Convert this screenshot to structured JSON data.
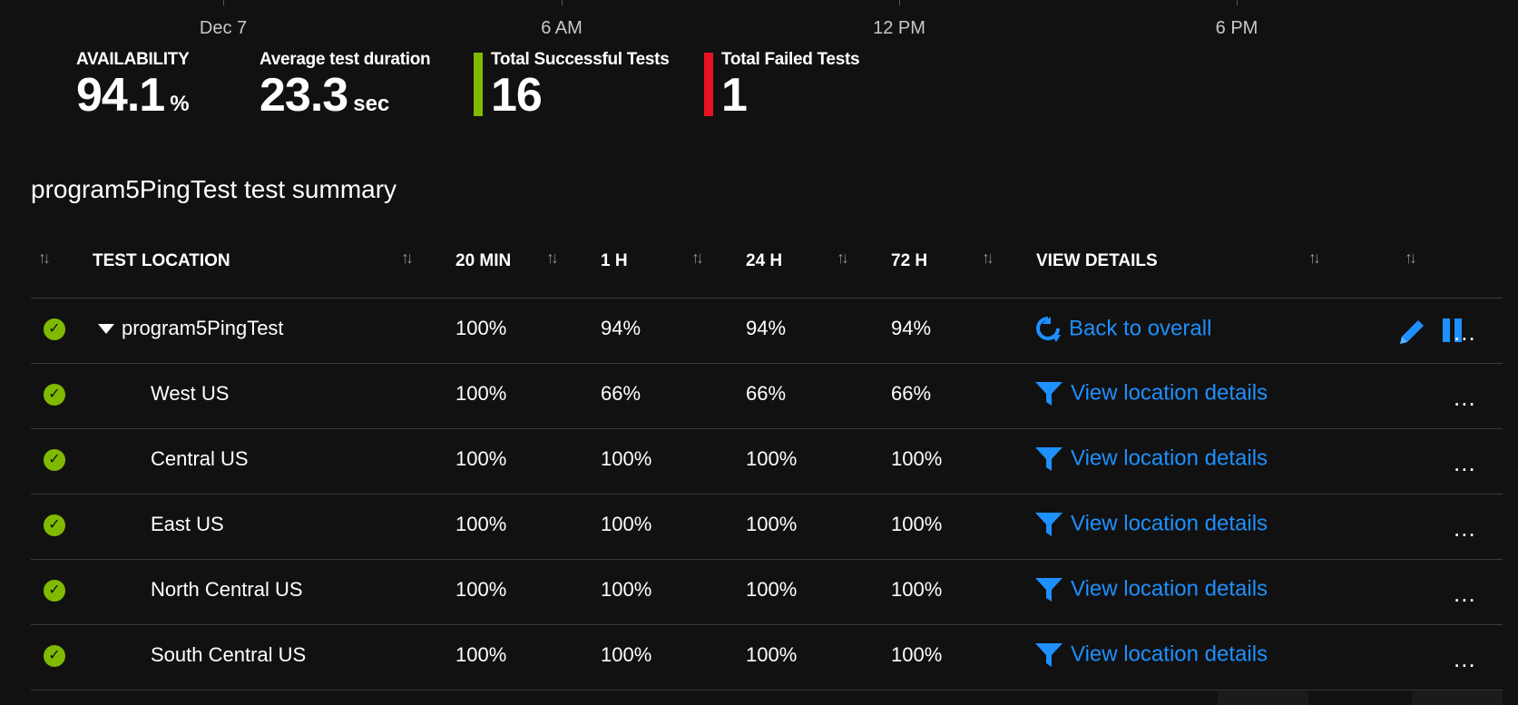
{
  "axis": {
    "labels": [
      "Dec 7",
      "6 AM",
      "12 PM",
      "6 PM"
    ]
  },
  "metrics": {
    "availability": {
      "label": "AVAILABILITY",
      "value": "94.1",
      "unit": "%"
    },
    "duration": {
      "label": "Average test duration",
      "value": "23.3",
      "unit": "sec"
    },
    "successful": {
      "label": "Total Successful Tests",
      "value": "16",
      "color": "#7fba00"
    },
    "failed": {
      "label": "Total Failed Tests",
      "value": "1",
      "color": "#e81123"
    }
  },
  "summary_title": "program5PingTest test summary",
  "table": {
    "columns": [
      "TEST LOCATION",
      "20 MIN",
      "1 H",
      "24 H",
      "72 H",
      "VIEW DETAILS"
    ],
    "rows": [
      {
        "location": "program5PingTest",
        "m20": "100%",
        "h1": "94%",
        "h24": "94%",
        "h72": "94%",
        "action": "Back to overall",
        "icon": "back-arrow-icon"
      },
      {
        "location": "West US",
        "m20": "100%",
        "h1": "66%",
        "h24": "66%",
        "h72": "66%",
        "action": "View location details",
        "icon": "filter-icon"
      },
      {
        "location": "Central US",
        "m20": "100%",
        "h1": "100%",
        "h24": "100%",
        "h72": "100%",
        "action": "View location details",
        "icon": "filter-icon"
      },
      {
        "location": "East US",
        "m20": "100%",
        "h1": "100%",
        "h24": "100%",
        "h72": "100%",
        "action": "View location details",
        "icon": "filter-icon"
      },
      {
        "location": "North Central US",
        "m20": "100%",
        "h1": "100%",
        "h24": "100%",
        "h72": "100%",
        "action": "View location details",
        "icon": "filter-icon"
      },
      {
        "location": "South Central US",
        "m20": "100%",
        "h1": "100%",
        "h24": "100%",
        "h72": "100%",
        "action": "View location details",
        "icon": "filter-icon"
      }
    ],
    "more_label": "...",
    "status_icon": "success-check-icon",
    "status_glyph": "✓",
    "sort_glyph": "↑↓"
  },
  "colors": {
    "link": "#1e90ff",
    "success": "#7fba00",
    "failed": "#e81123",
    "background": "#111111"
  }
}
